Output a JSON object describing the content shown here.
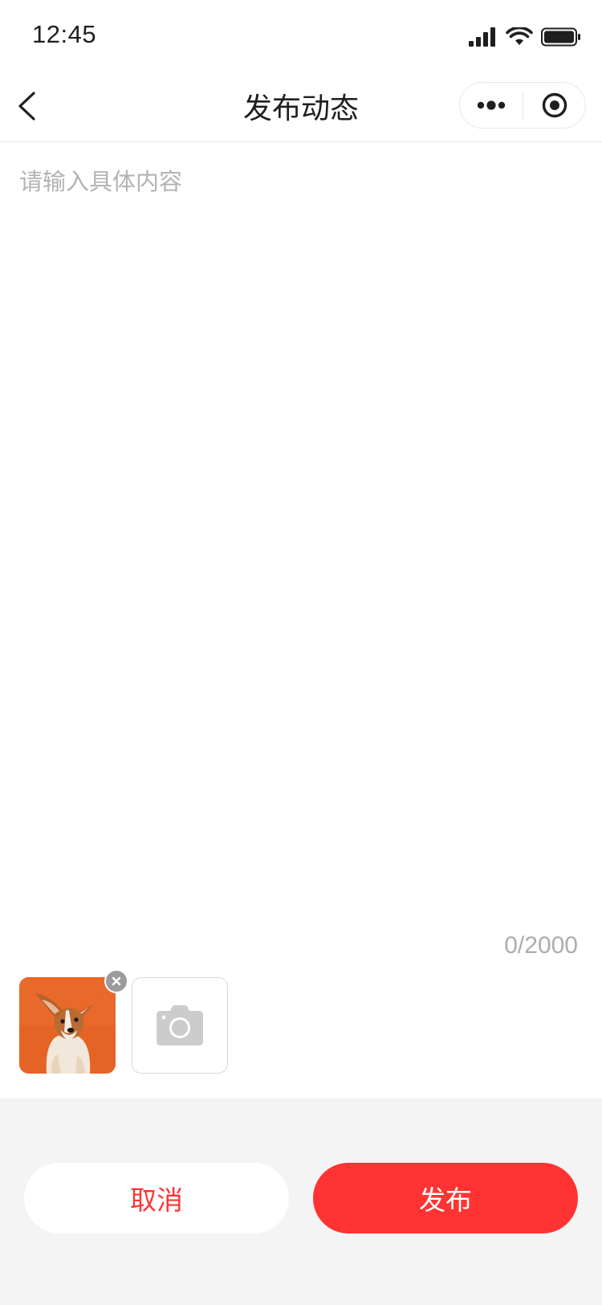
{
  "status_bar": {
    "time": "12:45"
  },
  "nav": {
    "title": "发布动态",
    "back_icon": "chevron-left-icon",
    "more_icon": "more-dots-icon",
    "close_icon": "target-close-icon"
  },
  "editor": {
    "placeholder": "请输入具体内容",
    "value": "",
    "char_count": "0/2000"
  },
  "images": {
    "items": [
      {
        "subject": "corgi puppy on orange background",
        "remove_icon": "close-icon"
      }
    ],
    "add_icon": "camera-icon"
  },
  "actions": {
    "cancel_label": "取消",
    "publish_label": "发布"
  },
  "colors": {
    "accent": "#ff3333",
    "footer_bg": "#f4f4f4",
    "placeholder": "#b3b3b3"
  }
}
